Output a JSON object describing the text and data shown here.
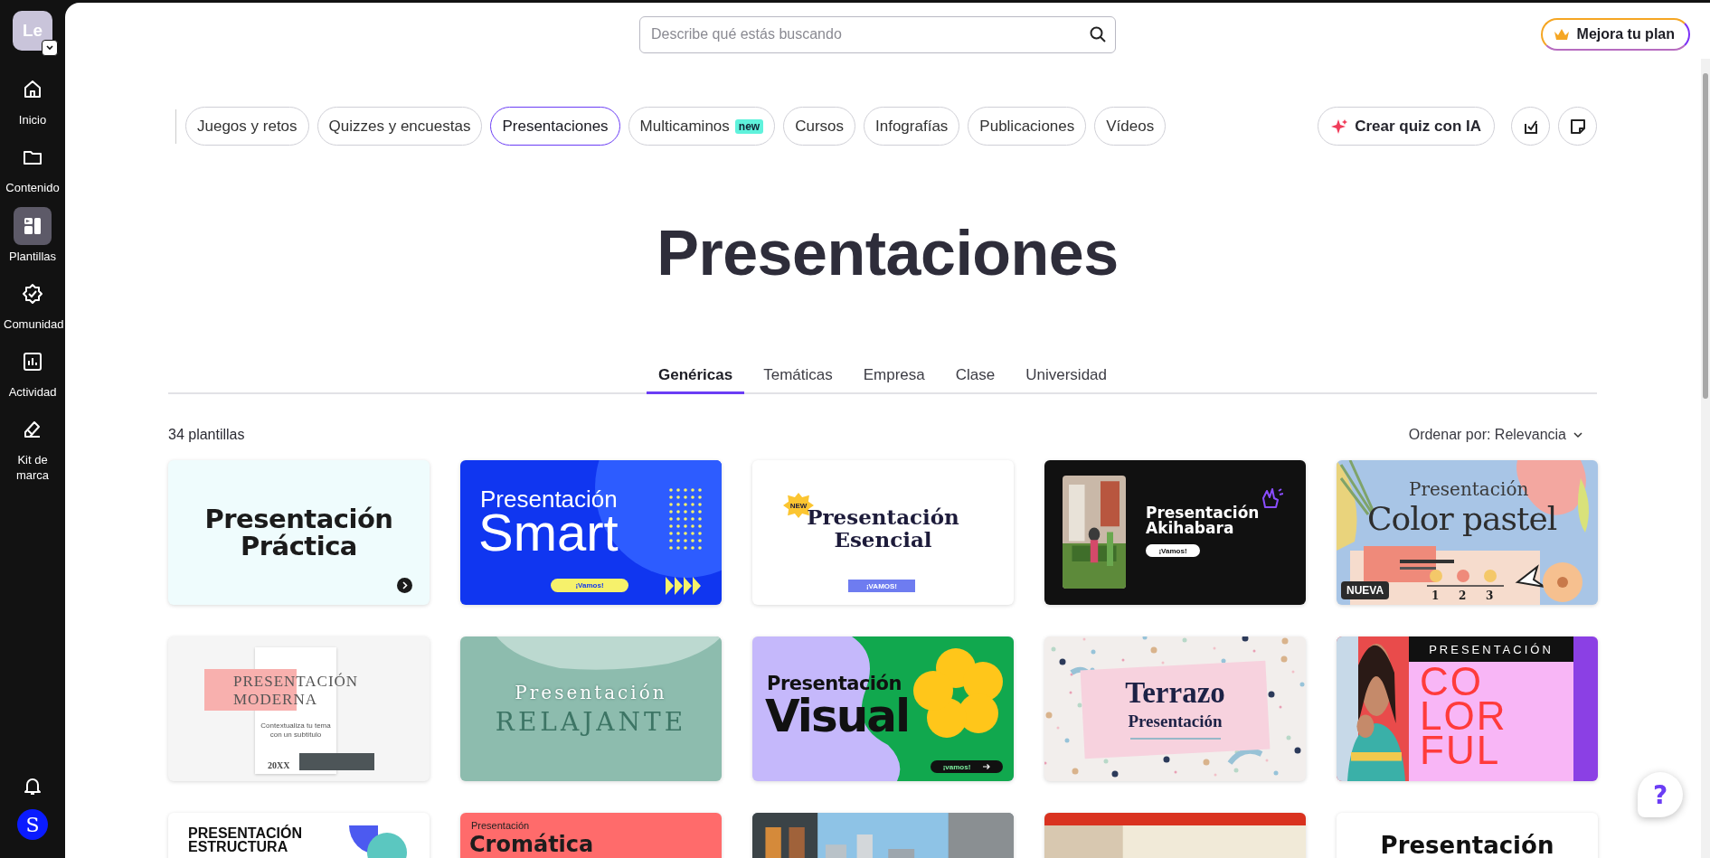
{
  "workspace": {
    "initials": "Le"
  },
  "sidebar": {
    "items": [
      {
        "label": "Inicio",
        "selected": false
      },
      {
        "label": "Contenido",
        "selected": false
      },
      {
        "label": "Plantillas",
        "selected": true
      },
      {
        "label": "Comunidad",
        "selected": false
      },
      {
        "label": "Actividad",
        "selected": false
      },
      {
        "label": "Kit de marca",
        "selected": false
      }
    ],
    "profile": {
      "initial": "S"
    }
  },
  "search": {
    "placeholder": "Describe qué estás buscando"
  },
  "upgrade_button": {
    "label": "Mejora tu plan"
  },
  "categories": [
    {
      "label": "Juegos y retos",
      "selected": false
    },
    {
      "label": "Quizzes y encuestas",
      "selected": false
    },
    {
      "label": "Presentaciones",
      "selected": true
    },
    {
      "label": "Multicaminos",
      "selected": false,
      "badge": "new"
    },
    {
      "label": "Cursos",
      "selected": false
    },
    {
      "label": "Infografías",
      "selected": false
    },
    {
      "label": "Publicaciones",
      "selected": false
    },
    {
      "label": "Vídeos",
      "selected": false
    }
  ],
  "actions": {
    "ai_button": "Crear quiz con IA"
  },
  "title": "Presentaciones",
  "subtabs": [
    {
      "label": "Genéricas",
      "selected": true
    },
    {
      "label": "Temáticas",
      "selected": false
    },
    {
      "label": "Empresa",
      "selected": false
    },
    {
      "label": "Clase",
      "selected": false
    },
    {
      "label": "Universidad",
      "selected": false
    }
  ],
  "results_count": "34 plantillas",
  "sort": {
    "label": "Ordenar por: Relevancia"
  },
  "cards": [
    {
      "kind": "practica",
      "lines": [
        "Presentación",
        "Práctica"
      ]
    },
    {
      "kind": "smart",
      "lines": [
        "Presentación",
        "Smart"
      ],
      "cta": "¡Vamos!"
    },
    {
      "kind": "esencial",
      "lines": [
        "Presentación",
        "Esencial"
      ],
      "cta": "¡VAMOS!",
      "badge": "NEW"
    },
    {
      "kind": "akihabara",
      "lines": [
        "Presentación",
        "Akihabara"
      ],
      "cta": "¡Vamos!"
    },
    {
      "kind": "pastel",
      "lines": [
        "Presentación",
        "Color pastel"
      ],
      "badge": "NUEVA",
      "steps": [
        "1",
        "2",
        "3"
      ]
    },
    {
      "kind": "moderna",
      "lines": [
        "PRESENTACIÓN",
        "MODERNA"
      ],
      "subtitle": "Contextualiza tu tema con un subtítulo",
      "year": "20XX"
    },
    {
      "kind": "relajante",
      "lines": [
        "Presentación",
        "RELAJANTE"
      ]
    },
    {
      "kind": "visual",
      "lines": [
        "Presentación",
        "Visual"
      ],
      "cta": "¡vamos!"
    },
    {
      "kind": "terrazo",
      "lines": [
        "Terrazo",
        "Presentación"
      ]
    },
    {
      "kind": "colorful",
      "lines": [
        "PRESENTACIÓN",
        "CO",
        "LOR",
        "FUL"
      ]
    },
    {
      "kind": "estructura",
      "lines": [
        "PRESENTACIÓN",
        "ESTRUCTURA"
      ]
    },
    {
      "kind": "cromatica",
      "lines": [
        "Presentación",
        "Cromática"
      ]
    },
    {
      "kind": "city"
    },
    {
      "kind": "poster"
    },
    {
      "kind": "plain",
      "lines": [
        "Presentación"
      ]
    }
  ],
  "help_button": {
    "label": "?"
  }
}
